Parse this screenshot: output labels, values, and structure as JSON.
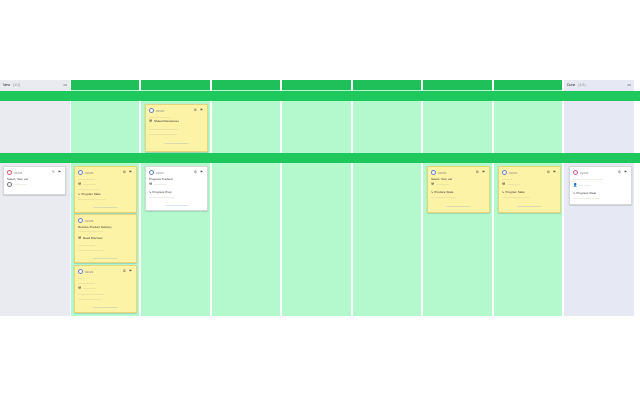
{
  "columns": [
    {
      "key": "new",
      "label": "New",
      "count": "(1/1)",
      "menu": "•••",
      "bg": "#eaeaf1",
      "hdr": "#eaeaf1"
    },
    {
      "key": "c2",
      "label": "",
      "count": "",
      "menu": "",
      "bg": "#b3f9cd",
      "hdr": "#1fbf5a"
    },
    {
      "key": "c3",
      "label": "",
      "count": "",
      "menu": "",
      "bg": "#b3f9cd",
      "hdr": "#1fbf5a"
    },
    {
      "key": "c4",
      "label": "",
      "count": "",
      "menu": "",
      "bg": "#b3f9cd",
      "hdr": "#1fbf5a"
    },
    {
      "key": "c5",
      "label": "",
      "count": "",
      "menu": "",
      "bg": "#b3f9cd",
      "hdr": "#1fbf5a"
    },
    {
      "key": "c6",
      "label": "",
      "count": "",
      "menu": "",
      "bg": "#b3f9cd",
      "hdr": "#1fbf5a"
    },
    {
      "key": "c7",
      "label": "",
      "count": "",
      "menu": "",
      "bg": "#b3f9cd",
      "hdr": "#1fbf5a"
    },
    {
      "key": "c8",
      "label": "",
      "count": "",
      "menu": "",
      "bg": "#b3f9cd",
      "hdr": "#1fbf5a"
    },
    {
      "key": "done",
      "label": "Done",
      "count": "(1/1)",
      "menu": "•••",
      "bg": "#e6e9f4",
      "hdr": "#e6e9f4"
    }
  ],
  "cards": [
    {
      "col": "c3",
      "lane": 1,
      "color": "yellow",
      "avatar": "blue",
      "id": "#2020",
      "icons": "⚙ ⚑",
      "line1": "",
      "line2": "Prepare",
      "line3": "Shared Resources",
      "line4": "",
      "footer": ""
    },
    {
      "col": "new",
      "lane": 2,
      "color": "white",
      "avatar": "red",
      "id": "#2025",
      "icons": "✎ ⚑",
      "line1": "Select, Test, etc",
      "line2": "",
      "line3": "",
      "line4": "",
      "footer": ""
    },
    {
      "col": "c2",
      "lane": 2,
      "color": "yellow",
      "avatar": "blue",
      "id": "#2026",
      "icons": "⚙ ⚑",
      "line1": "",
      "line2": "",
      "line3": "",
      "line4": "Program Slate",
      "footer": ""
    },
    {
      "col": "c3",
      "lane": 2,
      "color": "white",
      "avatar": "blue",
      "id": "#2027",
      "icons": "⚙ ⚑",
      "line1": "Progress Tracked",
      "line2": "",
      "line3": "",
      "line4": "Progress Prep",
      "footer": ""
    },
    {
      "col": "c2",
      "lane": 3,
      "color": "yellow",
      "avatar": "blue",
      "id": "#2028",
      "icons": "",
      "line1": "Resolve Product Delivery",
      "line2": "",
      "line3": "Deed Discover",
      "line4": "",
      "footer": ""
    },
    {
      "col": "c2",
      "lane": 4,
      "color": "yellow",
      "avatar": "blue",
      "id": "#2029",
      "icons": "⚙ ⚑",
      "line1": "",
      "line2": "",
      "line3": "",
      "line4": "",
      "footer": ""
    },
    {
      "col": "c7",
      "lane": 2,
      "color": "yellow",
      "avatar": "blue",
      "id": "#2030",
      "icons": "⚙ ⚑",
      "line1": "Select, Test, etc",
      "line2": "",
      "line3": "",
      "line4": "Produce State",
      "footer": ""
    },
    {
      "col": "c8",
      "lane": 2,
      "color": "yellow",
      "avatar": "blue",
      "id": "#2031",
      "icons": "⚙ ⚑",
      "line1": "",
      "line2": "",
      "line3": "",
      "line4": "Program State",
      "footer": ""
    },
    {
      "col": "done",
      "lane": 2,
      "color": "white",
      "avatar": "pink",
      "id": "#2032",
      "icons": "⚙ ⚑",
      "line1": "",
      "line2": "",
      "line3": "",
      "line4": "Progress State",
      "footer": ""
    }
  ]
}
